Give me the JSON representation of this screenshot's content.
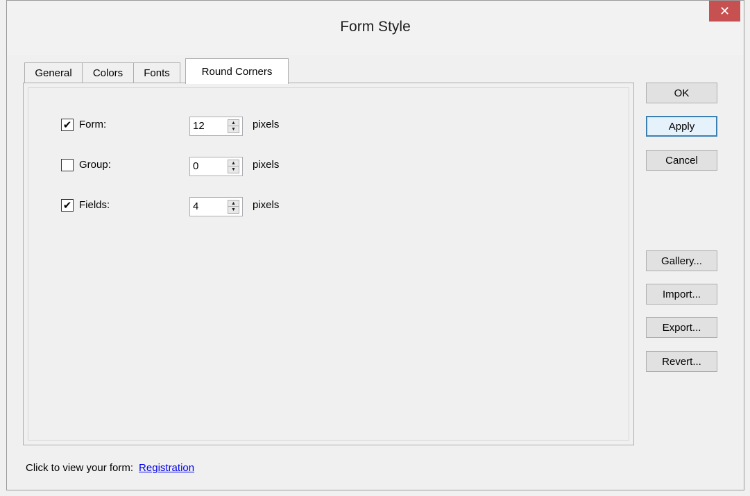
{
  "window": {
    "title": "Form Style",
    "close_glyph": "✕"
  },
  "tabs": [
    {
      "label": "General"
    },
    {
      "label": "Colors"
    },
    {
      "label": "Fonts"
    },
    {
      "label": "Round Corners"
    }
  ],
  "settings": [
    {
      "label": "Form:",
      "checked": true,
      "value": "12",
      "unit": "pixels"
    },
    {
      "label": "Group:",
      "checked": false,
      "value": "0",
      "unit": "pixels"
    },
    {
      "label": "Fields:",
      "checked": true,
      "value": "4",
      "unit": "pixels"
    }
  ],
  "buttons": {
    "ok": "OK",
    "apply": "Apply",
    "cancel": "Cancel",
    "gallery": "Gallery...",
    "import": "Import...",
    "export": "Export...",
    "revert": "Revert..."
  },
  "footer": {
    "prompt": "Click to view your form:",
    "link": "Registration"
  },
  "colors": {
    "close_button": "#c75050",
    "link": "#0000ee",
    "default_button_border": "#3c7fb1"
  }
}
